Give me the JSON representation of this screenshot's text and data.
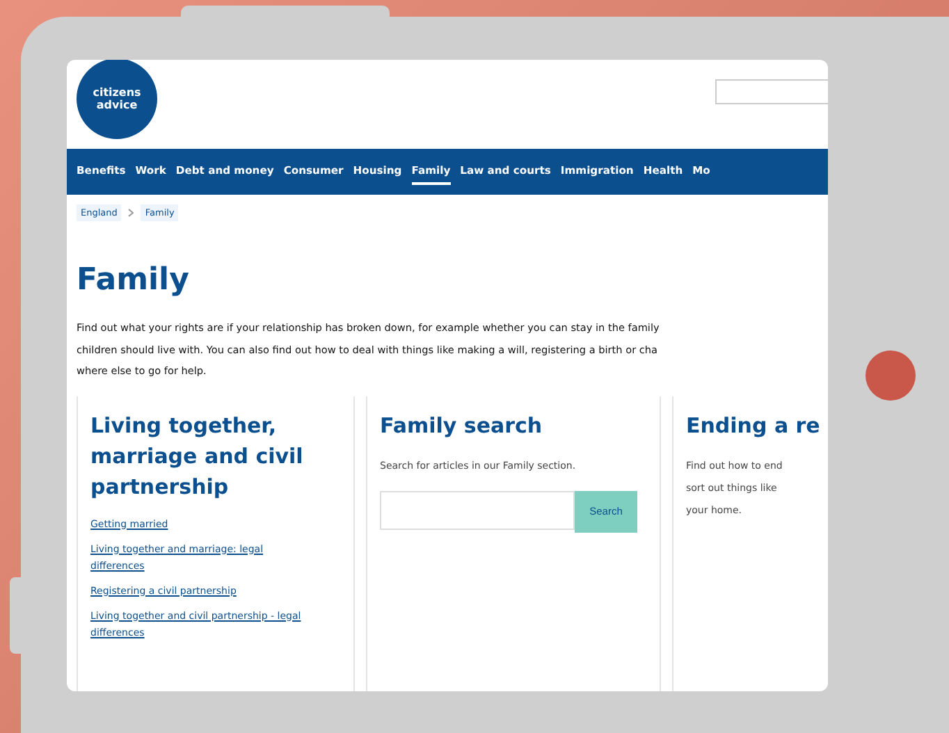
{
  "logo": {
    "lines": [
      "citizens",
      "advice"
    ]
  },
  "nav": [
    {
      "label": "Benefits",
      "selected": false
    },
    {
      "label": "Work",
      "selected": false
    },
    {
      "label": "Debt and money",
      "selected": false
    },
    {
      "label": "Consumer",
      "selected": false
    },
    {
      "label": "Housing",
      "selected": false
    },
    {
      "label": "Family",
      "selected": true
    },
    {
      "label": "Law and courts",
      "selected": false
    },
    {
      "label": "Immigration",
      "selected": false
    },
    {
      "label": "Health",
      "selected": false
    },
    {
      "label": "Mo",
      "selected": false
    }
  ],
  "breadcrumb": [
    "England",
    "Family"
  ],
  "title": "Family",
  "intro": [
    "Find out what your rights are if your relationship has broken down, for example whether you can stay in the family",
    "children should live with. You can also find out how to deal with things like making a will, registering a birth or cha",
    "where else to go for help."
  ],
  "columns": [
    {
      "kind": "links",
      "heading": "Living together, marriage and civil partnership",
      "links": [
        "Getting married",
        "Living together and marriage: legal differences",
        "Registering a civil partnership",
        "Living together and civil partnership - legal differences"
      ]
    },
    {
      "kind": "search",
      "heading": "Family search",
      "text": "Search for articles in our Family section.",
      "button": "Search"
    },
    {
      "kind": "text",
      "heading": "Ending a re",
      "lines": [
        "Find out how to end",
        "sort out things like",
        "your home."
      ]
    }
  ]
}
